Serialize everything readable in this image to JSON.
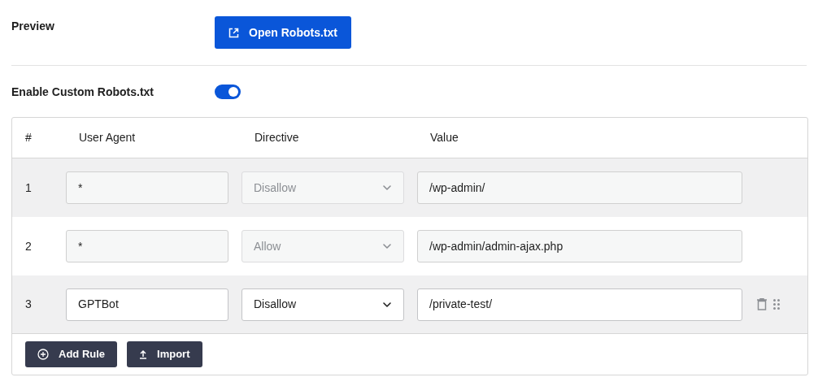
{
  "preview": {
    "label": "Preview",
    "button": "Open Robots.txt"
  },
  "enable": {
    "label": "Enable Custom Robots.txt",
    "on": true
  },
  "table": {
    "columns": [
      "#",
      "User Agent",
      "Directive",
      "Value"
    ],
    "rows": [
      {
        "number": "1",
        "user_agent": "*",
        "directive": "Disallow",
        "value": "/wp-admin/",
        "disabled": true,
        "shaded": true,
        "hovered": false
      },
      {
        "number": "2",
        "user_agent": "*",
        "directive": "Allow",
        "value": "/wp-admin/admin-ajax.php",
        "disabled": true,
        "shaded": false,
        "hovered": false
      },
      {
        "number": "3",
        "user_agent": "GPTBot",
        "directive": "Disallow",
        "value": "/private-test/",
        "disabled": false,
        "shaded": true,
        "hovered": true
      }
    ]
  },
  "buttons": [
    {
      "kind": "add",
      "label": "Add Rule"
    },
    {
      "kind": "import",
      "label": "Import"
    }
  ]
}
